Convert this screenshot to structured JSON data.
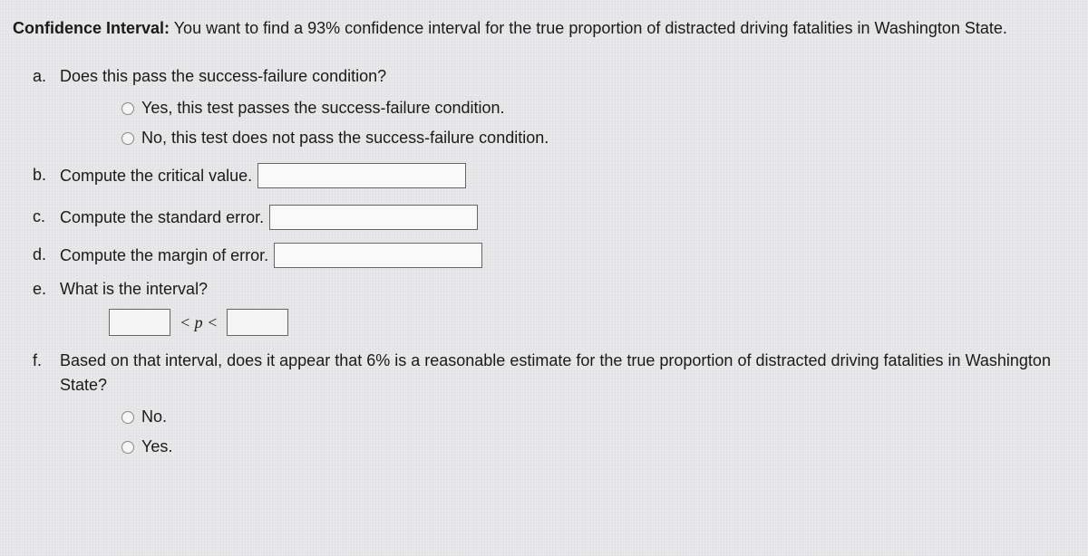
{
  "intro": {
    "bold": "Confidence Interval:",
    "text": " You want to find a 93% confidence interval for the true proportion of distracted driving fatalities in Washington State."
  },
  "questions": {
    "a": {
      "label": "a.",
      "text": "Does this pass the success-failure condition?",
      "options": [
        "Yes, this test passes the success-failure condition.",
        "No, this test does not pass the success-failure condition."
      ]
    },
    "b": {
      "label": "b.",
      "text": "Compute the critical value."
    },
    "c": {
      "label": "c.",
      "text": "Compute the standard error."
    },
    "d": {
      "label": "d.",
      "text": "Compute the margin of error."
    },
    "e": {
      "label": "e.",
      "text": "What is the interval?",
      "middle": "< p <"
    },
    "f": {
      "label": "f.",
      "text": "Based on that interval, does it appear that 6% is a reasonable estimate for the true proportion of distracted driving fatalities in Washington State?",
      "options": [
        "No.",
        "Yes."
      ]
    }
  }
}
